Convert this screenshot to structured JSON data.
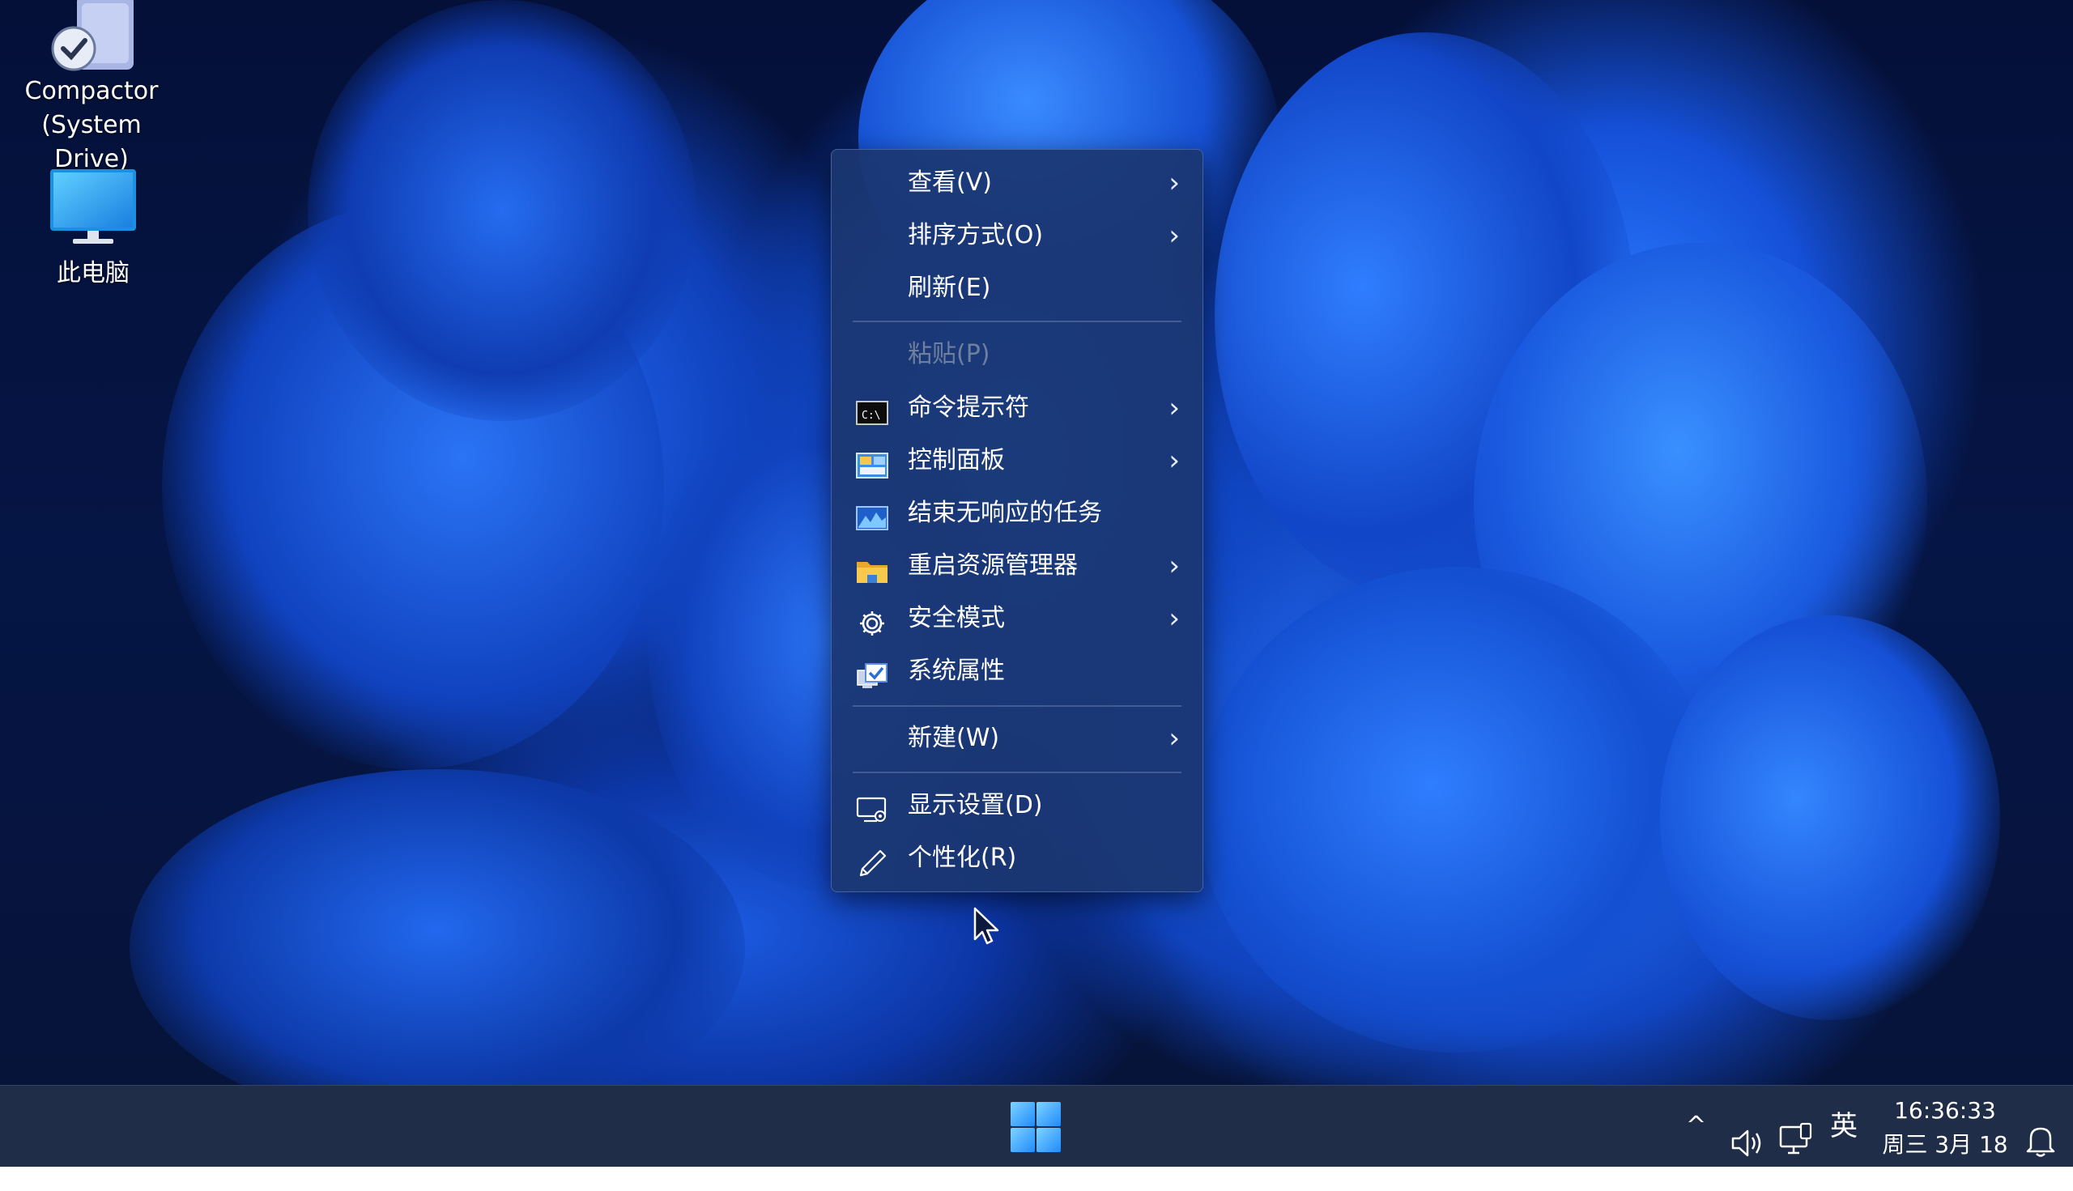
{
  "desktop": {
    "icons": [
      {
        "label_line1": "Compactor",
        "label_line2": "(System Drive)",
        "icon": "compactor-drive-icon"
      },
      {
        "label_line1": "此电脑",
        "icon": "monitor-icon"
      }
    ]
  },
  "context_menu": {
    "items": [
      {
        "label": "查看(V)",
        "has_submenu": true
      },
      {
        "label": "排序方式(O)",
        "has_submenu": true
      },
      {
        "label": "刷新(E)",
        "has_submenu": false
      },
      {
        "label": "粘贴(P)",
        "has_submenu": false,
        "disabled": true
      },
      {
        "label": "命令提示符",
        "has_submenu": true,
        "icon": "cmd-icon"
      },
      {
        "label": "控制面板",
        "has_submenu": true,
        "icon": "control-panel-icon"
      },
      {
        "label": "结束无响应的任务",
        "has_submenu": false,
        "icon": "task-chart-icon"
      },
      {
        "label": "重启资源管理器",
        "has_submenu": true,
        "icon": "folder-icon"
      },
      {
        "label": "安全模式",
        "has_submenu": true,
        "icon": "gear-icon"
      },
      {
        "label": "系统属性",
        "has_submenu": false,
        "icon": "system-properties-icon"
      },
      {
        "label": "新建(W)",
        "has_submenu": true
      },
      {
        "label": "显示设置(D)",
        "has_submenu": false,
        "icon": "display-settings-icon"
      },
      {
        "label": "个性化(R)",
        "has_submenu": false,
        "icon": "pen-icon"
      }
    ],
    "chevron": "›"
  },
  "taskbar": {
    "start_icon": "windows-logo-icon",
    "tray": {
      "overflow": "^",
      "ime": "英",
      "time": "16:36:33",
      "date": "周三 3月 18"
    }
  },
  "colors": {
    "menu_bg": "#1b3670",
    "taskbar_bg": "#162442",
    "accent": "#2a7cff"
  }
}
